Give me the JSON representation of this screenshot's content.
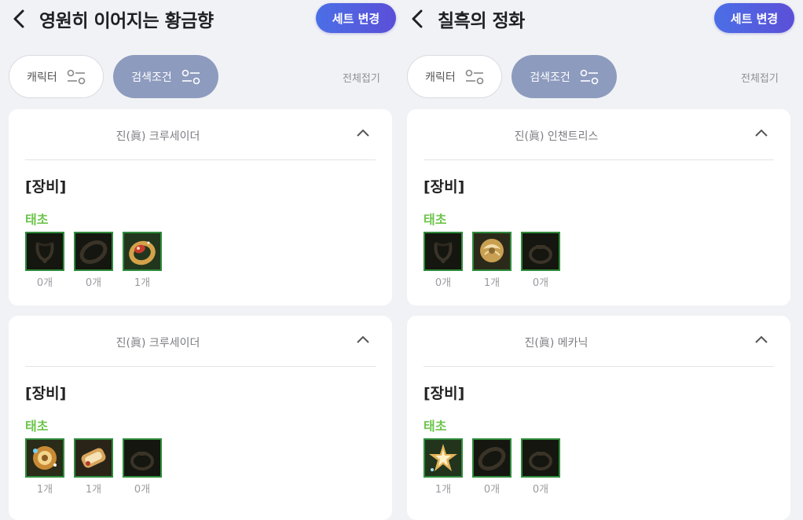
{
  "panels": [
    {
      "title": "영원히 이어지는 황금향",
      "set_button": "세트 변경",
      "filter_character": "캐릭터",
      "filter_search": "검색조건",
      "collapse_all": "전체접기",
      "cards": [
        {
          "name": "진(眞) 크루세이더",
          "section": "[장비]",
          "grade": "태초",
          "items": [
            {
              "icon": "necklace-empty-icon",
              "count": "0개"
            },
            {
              "icon": "bracelet-empty-icon",
              "count": "0개"
            },
            {
              "icon": "golden-ring-icon",
              "count": "1개"
            }
          ]
        },
        {
          "name": "진(眞) 크루세이더",
          "section": "[장비]",
          "grade": "태초",
          "items": [
            {
              "icon": "golden-ornament-icon",
              "count": "1개"
            },
            {
              "icon": "golden-bracelet-icon",
              "count": "1개"
            },
            {
              "icon": "ring-empty-icon",
              "count": "0개"
            }
          ]
        }
      ]
    },
    {
      "title": "칠흑의 정화",
      "set_button": "세트 변경",
      "filter_character": "캐릭터",
      "filter_search": "검색조건",
      "collapse_all": "전체접기",
      "cards": [
        {
          "name": "진(眞) 인챈트리스",
          "section": "[장비]",
          "grade": "태초",
          "items": [
            {
              "icon": "necklace-empty-icon",
              "count": "0개"
            },
            {
              "icon": "golden-rose-icon",
              "count": "1개"
            },
            {
              "icon": "ring-empty-icon",
              "count": "0개"
            }
          ]
        },
        {
          "name": "진(眞) 메카닉",
          "section": "[장비]",
          "grade": "태초",
          "items": [
            {
              "icon": "golden-star-icon",
              "count": "1개"
            },
            {
              "icon": "bracelet-empty-icon",
              "count": "0개"
            },
            {
              "icon": "ring-empty-icon",
              "count": "0개"
            }
          ]
        }
      ]
    }
  ],
  "colors": {
    "grade": "#6cc44a",
    "set_button_start": "#4b6fe6",
    "set_button_end": "#5b4fd8",
    "active_filter": "#8d9bbe"
  }
}
